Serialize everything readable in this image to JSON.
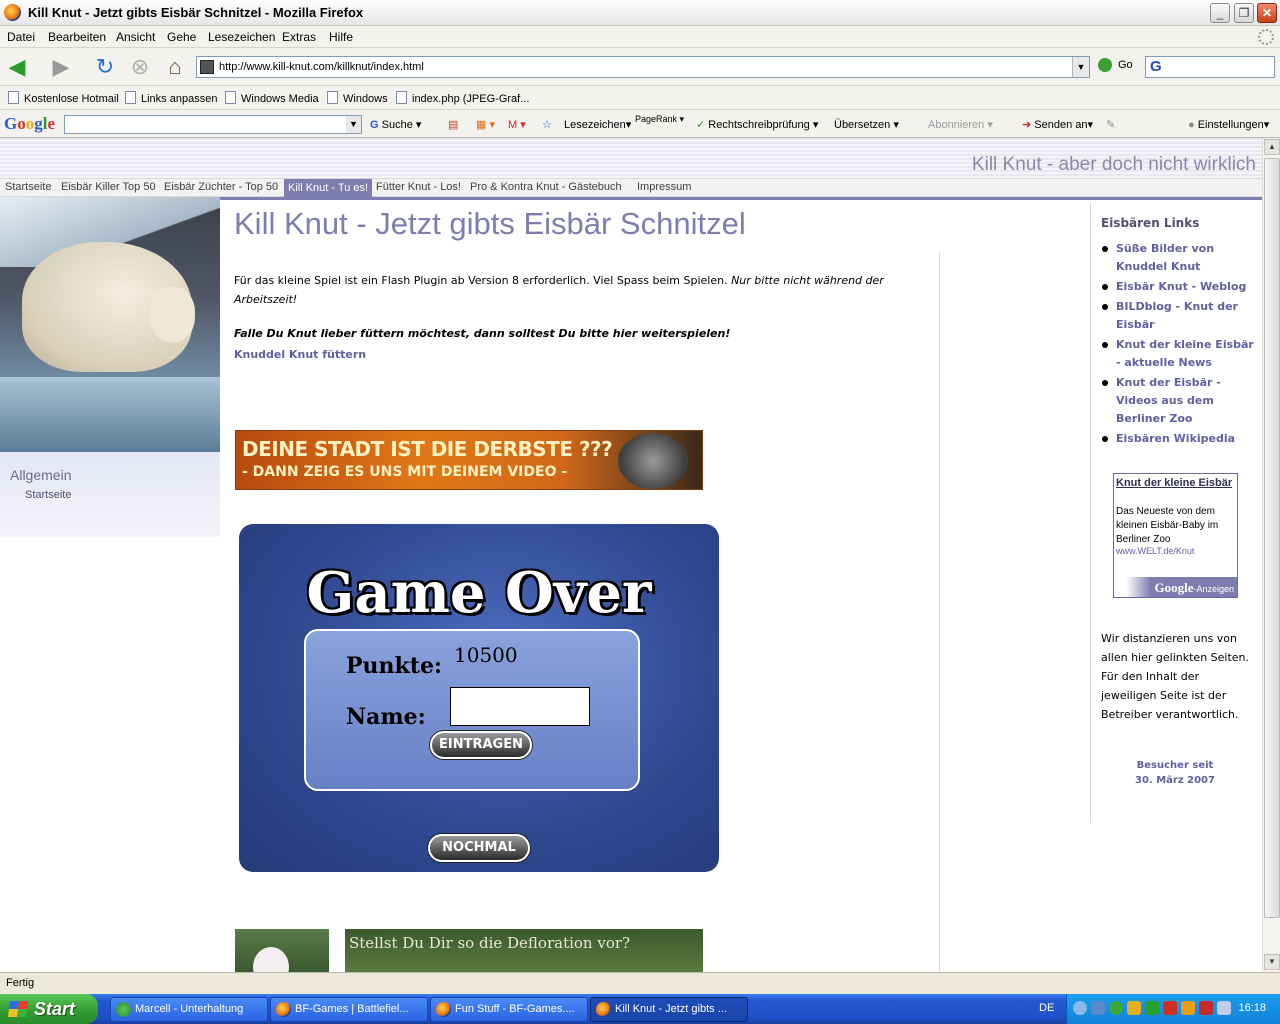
{
  "window": {
    "title": "Kill Knut - Jetzt gibts Eisbär Schnitzel - Mozilla Firefox",
    "min": "_",
    "max": "❐",
    "close": "✕"
  },
  "menu": [
    "Datei",
    "Bearbeiten",
    "Ansicht",
    "Gehe",
    "Lesezeichen",
    "Extras",
    "Hilfe"
  ],
  "nav": {
    "url": "http://www.kill-knut.com/killknut/index.html",
    "go_label": "Go",
    "back_icon": "back-arrow-icon",
    "forward_icon": "forward-arrow-icon",
    "reload_icon": "reload-icon",
    "stop_icon": "stop-icon",
    "home_icon": "home-icon"
  },
  "bookmarks": [
    "Kostenlose Hotmail",
    "Links anpassen",
    "Windows Media",
    "Windows",
    "index.php (JPEG-Graf..."
  ],
  "google_toolbar": {
    "logo": "Google",
    "search": "Suche",
    "bookmarks": "Lesezeichen",
    "pagerank": "PageRank",
    "spellcheck": "Rechtschreibprüfung",
    "translate": "Übersetzen",
    "subscribe": "Abonnieren",
    "send": "Senden an",
    "settings": "Einstellungen"
  },
  "site": {
    "tagline": "Kill Knut - aber doch nicht wirklich",
    "topnav": [
      "Startseite",
      "Eisbär Killer Top 50",
      "Eisbär Züchter - Top 50",
      "Kill Knut - Tu es!",
      "Fütter Knut - Los!",
      "Pro & Kontra Knut - Gästebuch",
      "Impressum"
    ],
    "left_menu": {
      "heading": "Allgemein",
      "item": "Startseite"
    },
    "heading": "Kill Knut - Jetzt gibts Eisbär Schnitzel",
    "intro_plain": "Für das kleine Spiel ist ein Flash Plugin ab Version 8 erforderlich. Viel Spass beim Spielen. ",
    "intro_italic": "Nur bitte nicht während der Arbeitszeit!",
    "feed_text": "Falle Du Knut lieber füttern möchtest, dann solltest Du bitte hier weiterspielen!",
    "feed_link": "Knuddel Knut füttern",
    "banner": {
      "line1": "DEINE STADT IST DIE DERBSTE ???",
      "line2": "- DANN ZEIG ES UNS MIT DEINEM VIDEO -"
    },
    "game": {
      "title": "Game Over",
      "points_label": "Punkte:",
      "points_value": "10500",
      "name_label": "Name:",
      "name_value": "",
      "submit": "EINTRAGEN",
      "again": "NOCHMAL"
    },
    "bottom_ad": "Stellst Du Dir so die Defloration vor?",
    "sidebar": {
      "heading": "Eisbären Links",
      "links": [
        "Süße Bilder von Knuddel Knut",
        "Eisbär Knut - Weblog",
        "BILDblog - Knut der Eisbär",
        "Knut der kleine Eisbär - aktuelle News",
        "Knut der Eisbär - Videos aus dem Berliner Zoo",
        "Eisbären Wikipedia"
      ],
      "ad": {
        "title": "Knut der kleine Eisbär",
        "desc": "Das Neueste von dem kleinen Eisbär-Baby im Berliner Zoo",
        "url": "www.WELT.de/Knut",
        "brand": "Google",
        "suffix": "-Anzeigen"
      },
      "disclaimer": "Wir distanzieren uns von allen hier gelinkten Seiten. Für den Inhalt der jeweiligen Seite ist der Betreiber verantwortlich.",
      "visitors_line1": "Besucher seit",
      "visitors_line2": "30. März 2007"
    }
  },
  "status": "Fertig",
  "taskbar": {
    "start": "Start",
    "tasks": [
      "Marcell - Unterhaltung",
      "BF-Games | Battlefiel...",
      "Fun Stuff - BF-Games....",
      "Kill Knut - Jetzt gibts ..."
    ],
    "lang": "DE",
    "clock": "16:18"
  }
}
